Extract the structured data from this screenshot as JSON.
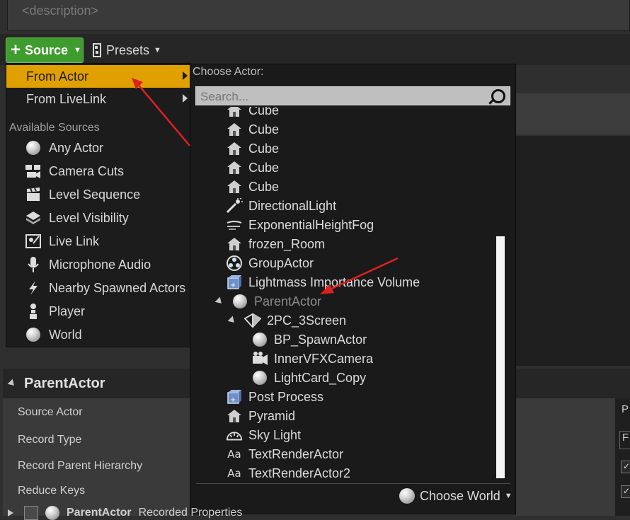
{
  "description_placeholder": "<description>",
  "toolbar": {
    "source_label": "Source",
    "presets_label": "Presets"
  },
  "left_menu": {
    "items": [
      {
        "label": "From Actor"
      },
      {
        "label": "From LiveLink"
      }
    ],
    "section_header": "Available Sources",
    "sources": [
      {
        "label": "Any Actor",
        "icon": "sphere-icon"
      },
      {
        "label": "Camera Cuts",
        "icon": "camera-cuts-icon"
      },
      {
        "label": "Level Sequence",
        "icon": "clapper-icon"
      },
      {
        "label": "Level Visibility",
        "icon": "level-visibility-icon"
      },
      {
        "label": "Live Link",
        "icon": "live-link-icon"
      },
      {
        "label": "Microphone Audio",
        "icon": "microphone-icon"
      },
      {
        "label": "Nearby Spawned Actors",
        "icon": "lightning-icon"
      },
      {
        "label": "Player",
        "icon": "pawn-icon"
      },
      {
        "label": "World",
        "icon": "sphere-icon"
      }
    ]
  },
  "submenu": {
    "title": "Choose Actor:",
    "search_placeholder": "Search...",
    "actors": [
      {
        "label": "Cube",
        "icon": "house-icon"
      },
      {
        "label": "Cube",
        "icon": "house-icon"
      },
      {
        "label": "Cube",
        "icon": "house-icon"
      },
      {
        "label": "Cube",
        "icon": "house-icon"
      },
      {
        "label": "Cube",
        "icon": "house-icon"
      },
      {
        "label": "DirectionalLight",
        "icon": "directional-light-icon"
      },
      {
        "label": "ExponentialHeightFog",
        "icon": "fog-icon"
      },
      {
        "label": "frozen_Room",
        "icon": "house-icon"
      },
      {
        "label": "GroupActor",
        "icon": "group-icon"
      },
      {
        "label": "Lightmass Importance Volume",
        "icon": "volume-icon"
      },
      {
        "label": "ParentActor",
        "icon": "sphere-icon"
      },
      {
        "label": "2PC_3Screen",
        "icon": "display-cluster-icon"
      },
      {
        "label": "BP_SpawnActor",
        "icon": "sphere-icon"
      },
      {
        "label": "InnerVFXCamera",
        "icon": "camera-icon"
      },
      {
        "label": "LightCard_Copy",
        "icon": "sphere-icon"
      },
      {
        "label": "Post Process",
        "icon": "volume-icon"
      },
      {
        "label": "Pyramid",
        "icon": "house-icon"
      },
      {
        "label": "Sky Light",
        "icon": "sky-light-icon"
      },
      {
        "label": "TextRenderActor",
        "icon": "text-icon"
      },
      {
        "label": "TextRenderActor2",
        "icon": "text-icon"
      }
    ],
    "choose_world_label": "Choose World"
  },
  "details": {
    "header": "ParentActor",
    "properties": [
      {
        "label": "Source Actor"
      },
      {
        "label": "Record Type"
      },
      {
        "label": "Record Parent Hierarchy"
      },
      {
        "label": "Reduce Keys"
      }
    ],
    "bottom_row": {
      "name": "ParentActor",
      "suffix": "Recorded Properties"
    },
    "edge_letters": [
      "P",
      "F"
    ]
  },
  "colors": {
    "accent_active": "#e0a000",
    "source_green": "#3f9c2f",
    "annotation_arrow": "#e02020"
  }
}
